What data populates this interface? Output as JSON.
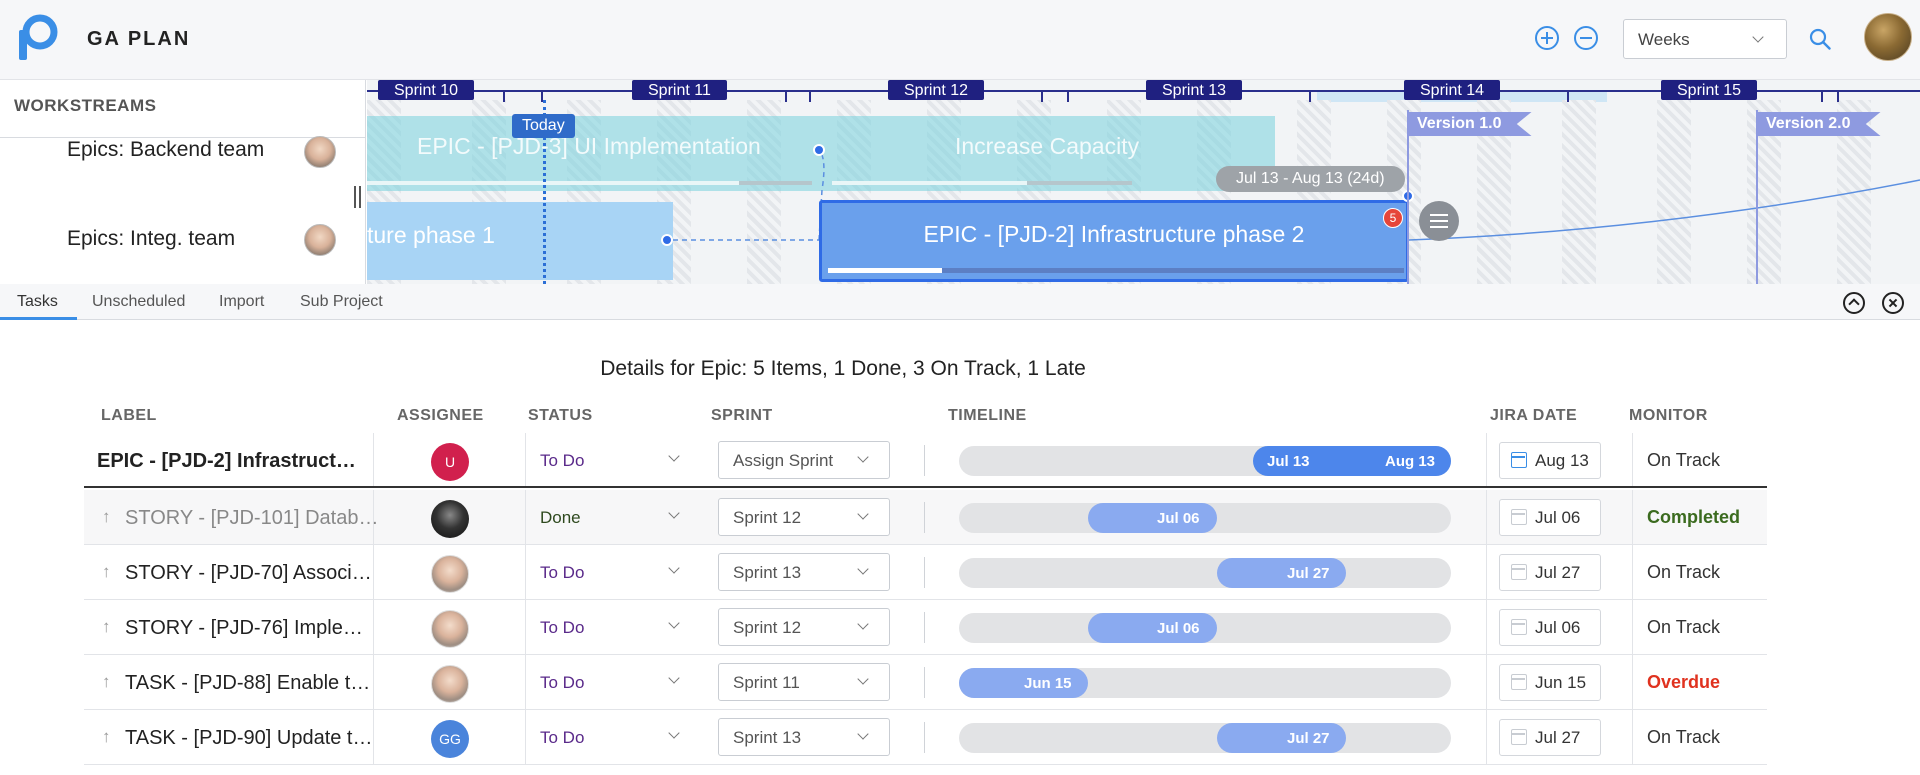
{
  "header": {
    "app_title": "GA PLAN",
    "scale_select": "Weeks",
    "icons": [
      "logo-icon",
      "zoom-in-icon",
      "zoom-out-icon",
      "search-icon",
      "user-avatar"
    ],
    "accent": "#3a8ee6"
  },
  "gantt": {
    "workstreams_title": "WORKSTREAMS",
    "rows": [
      {
        "label": "Epics: Backend team"
      },
      {
        "label": "Epics: Integ. team"
      }
    ],
    "sprints": [
      "Sprint 10",
      "Sprint 11",
      "Sprint 12",
      "Sprint 13",
      "Sprint 14",
      "Sprint 15"
    ],
    "today_label": "Today",
    "bars": {
      "ui_impl": "EPIC - [PJD-3] UI Implementation",
      "capacity": "Increase Capacity",
      "phase1": "ture phase 1",
      "phase2": "EPIC - [PJD-2] Infrastructure phase 2"
    },
    "date_tooltip": "Jul 13 - Aug 13 (24d)",
    "phase2_badge": "5",
    "versions": [
      "Version 1.0",
      "Version 2.0"
    ]
  },
  "tabs": {
    "items": [
      "Tasks",
      "Unscheduled",
      "Import",
      "Sub Project"
    ],
    "active": "Tasks"
  },
  "details": {
    "title": "Details for Epic: 5 Items, 1 Done, 3 On Track, 1 Late",
    "columns": [
      "LABEL",
      "ASSIGNEE",
      "STATUS",
      "SPRINT",
      "TIMELINE",
      "JIRA DATE",
      "MONITOR"
    ],
    "rows": [
      {
        "label": "EPIC - [PJD-2] Infrastruct…",
        "assignee": "U",
        "status": "To Do",
        "sprint": "Assign Sprint",
        "timeline_start": "Jul 13",
        "timeline_end": "Aug 13",
        "jira_date": "Aug 13",
        "monitor": "On Track"
      },
      {
        "label": "STORY - [PJD-101] Datab…",
        "assignee": "",
        "status": "Done",
        "sprint": "Sprint 12",
        "timeline_start": "Jul 06",
        "jira_date": "Jul 06",
        "monitor": "Completed"
      },
      {
        "label": "STORY - [PJD-70] Associ…",
        "assignee": "",
        "status": "To Do",
        "sprint": "Sprint 13",
        "timeline_start": "Jul 27",
        "jira_date": "Jul 27",
        "monitor": "On Track"
      },
      {
        "label": "STORY - [PJD-76] Imple…",
        "assignee": "",
        "status": "To Do",
        "sprint": "Sprint 12",
        "timeline_start": "Jul 06",
        "jira_date": "Jul 06",
        "monitor": "On Track"
      },
      {
        "label": "TASK - [PJD-88] Enable t…",
        "assignee": "",
        "status": "To Do",
        "sprint": "Sprint 11",
        "timeline_start": "Jun 15",
        "jira_date": "Jun 15",
        "monitor": "Overdue"
      },
      {
        "label": "TASK - [PJD-90] Update t…",
        "assignee": "GG",
        "status": "To Do",
        "sprint": "Sprint 13",
        "timeline_start": "Jul 27",
        "jira_date": "Jul 27",
        "monitor": "On Track"
      }
    ]
  },
  "colors": {
    "completed": "#3b6b1f",
    "overdue": "#e0321f",
    "todo": "#5a2a8a",
    "sprint_label_bg": "#1f2080",
    "timeline_fill": "#8aaaf0"
  }
}
